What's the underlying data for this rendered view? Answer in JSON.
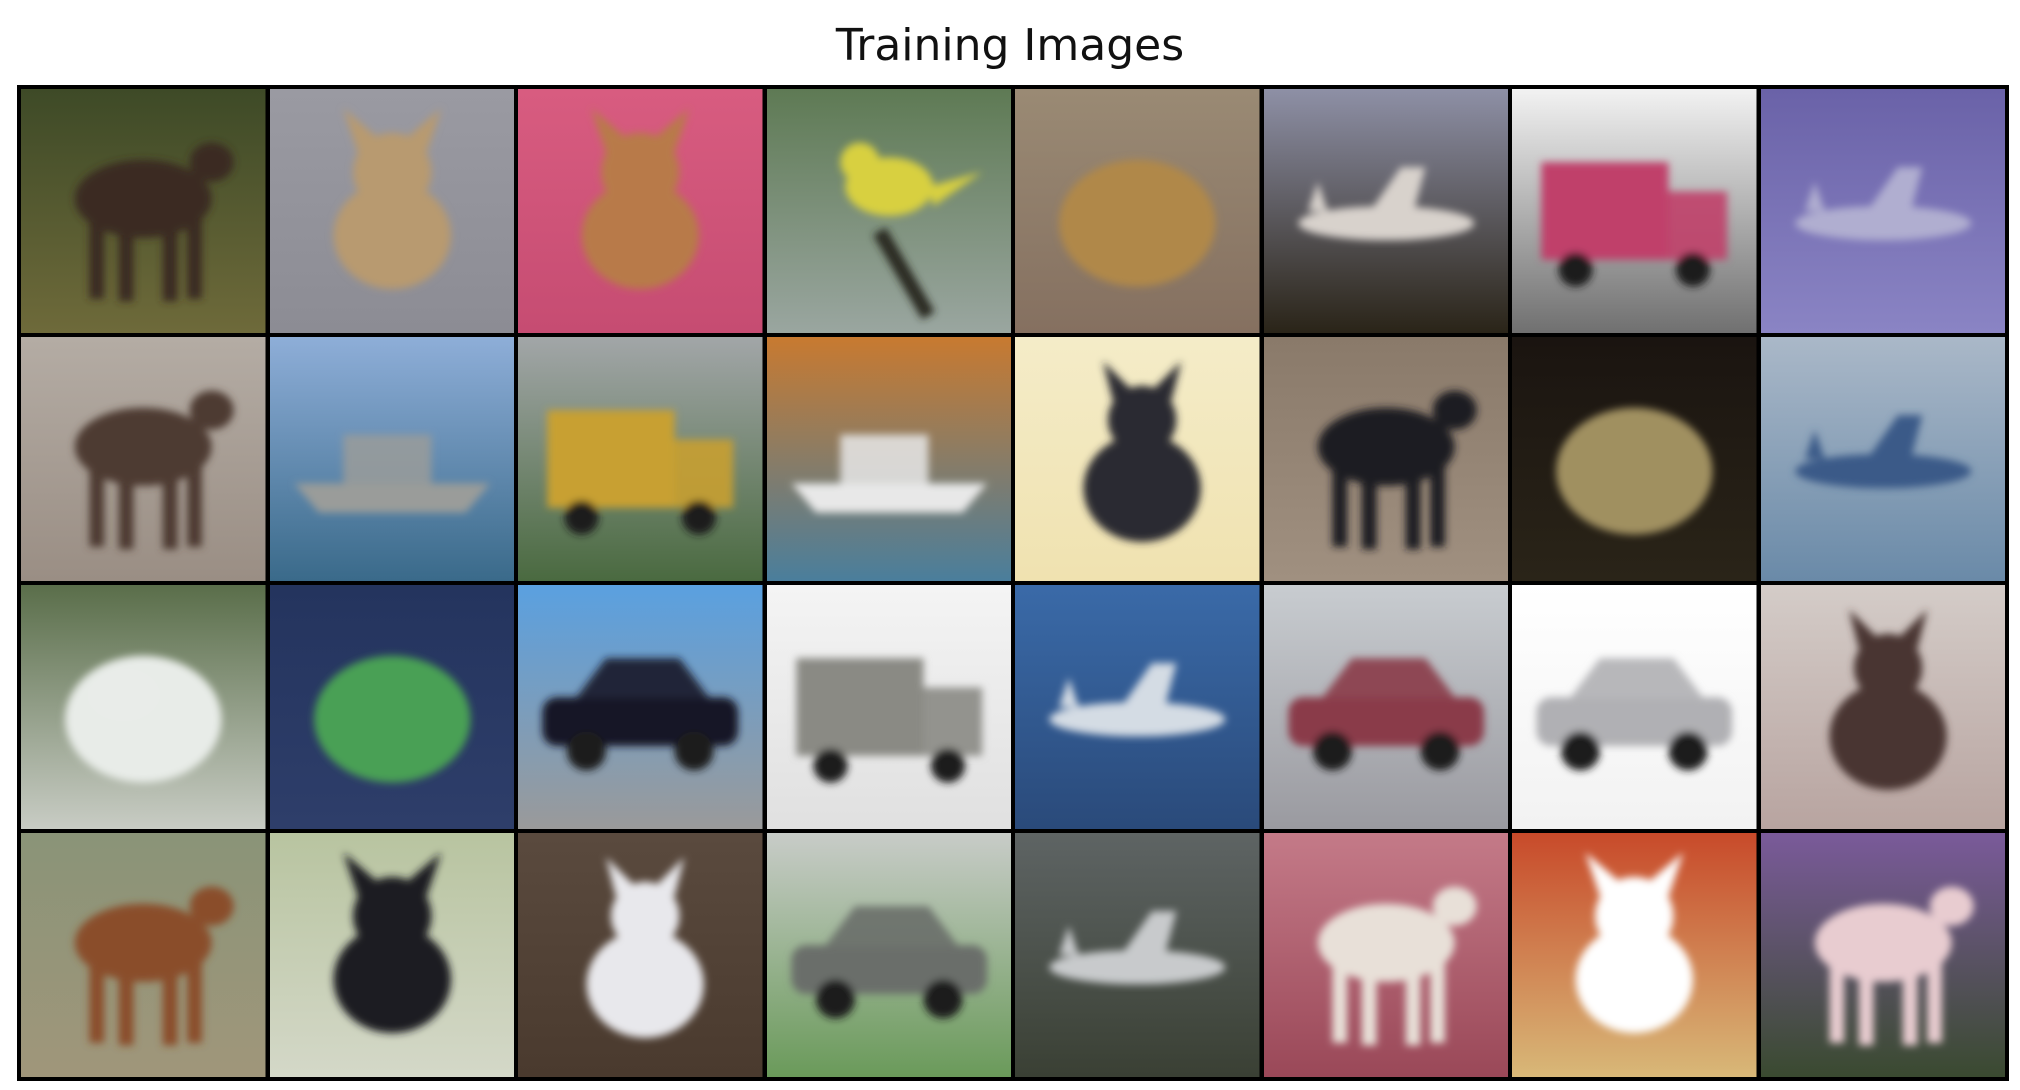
{
  "title": "Training Images",
  "grid": {
    "rows": 4,
    "cols": 8
  },
  "images": [
    {
      "subject": "moose",
      "bg": [
        "#3e4a27",
        "#6e6a3a"
      ],
      "fg": "#3a2a20",
      "shape": "quad"
    },
    {
      "subject": "dog",
      "bg": [
        "#9a9aa2",
        "#8c8c94"
      ],
      "fg": "#b89a70",
      "shape": "dog"
    },
    {
      "subject": "dog",
      "bg": [
        "#d85c80",
        "#c64c72"
      ],
      "fg": "#b87a48",
      "shape": "dog"
    },
    {
      "subject": "bird",
      "bg": [
        "#5e7a54",
        "#9aa6a0"
      ],
      "fg": "#d8d040",
      "shape": "bird"
    },
    {
      "subject": "frog",
      "bg": [
        "#9a8a74",
        "#857060"
      ],
      "fg": "#b08848",
      "shape": "blob"
    },
    {
      "subject": "airplane",
      "bg": [
        "#8e90a6",
        "#2a2418"
      ],
      "fg": "#d8d2cc",
      "shape": "plane"
    },
    {
      "subject": "truck",
      "bg": [
        "#f2f2f2",
        "#707070"
      ],
      "fg": "#c0406a",
      "shape": "truck"
    },
    {
      "subject": "airplane",
      "bg": [
        "#6a62a8",
        "#8a84c4"
      ],
      "fg": "#b0aed0",
      "shape": "plane"
    },
    {
      "subject": "deer",
      "bg": [
        "#b4aca4",
        "#9a8e84"
      ],
      "fg": "#4e3a30",
      "shape": "quad"
    },
    {
      "subject": "ship",
      "bg": [
        "#8eaed8",
        "#3a6a8a"
      ],
      "fg": "#9a9c9a",
      "shape": "ship"
    },
    {
      "subject": "truck",
      "bg": [
        "#a2a6a8",
        "#4a6a40"
      ],
      "fg": "#c8a030",
      "shape": "truck"
    },
    {
      "subject": "ship",
      "bg": [
        "#c87a30",
        "#4a7e9c"
      ],
      "fg": "#e8e8e8",
      "shape": "ship"
    },
    {
      "subject": "cat",
      "bg": [
        "#f4ecc8",
        "#f0e2b0"
      ],
      "fg": "#2a2a30",
      "shape": "cat"
    },
    {
      "subject": "horse",
      "bg": [
        "#8a7a6a",
        "#a09080"
      ],
      "fg": "#1e1a20",
      "shape": "quad"
    },
    {
      "subject": "frog",
      "bg": [
        "#1a1410",
        "#2a2418"
      ],
      "fg": "#a09060",
      "shape": "blob"
    },
    {
      "subject": "airplane",
      "bg": [
        "#aab8c8",
        "#6a8aa8"
      ],
      "fg": "#3a5a88",
      "shape": "plane"
    },
    {
      "subject": "deer",
      "bg": [
        "#5a6e4a",
        "#c8ccc4"
      ],
      "fg": "#e8ece8",
      "shape": "blob"
    },
    {
      "subject": "frog",
      "bg": [
        "#24345e",
        "#2e3e6a"
      ],
      "fg": "#4aa054",
      "shape": "blob"
    },
    {
      "subject": "automobile",
      "bg": [
        "#5aa0e0",
        "#9a9a9a"
      ],
      "fg": "#141828",
      "shape": "car"
    },
    {
      "subject": "truck",
      "bg": [
        "#f4f4f4",
        "#e0e0e0"
      ],
      "fg": "#8a8a84",
      "shape": "truck"
    },
    {
      "subject": "airplane",
      "bg": [
        "#3a6aa8",
        "#2a4a7a"
      ],
      "fg": "#d4dce4",
      "shape": "plane"
    },
    {
      "subject": "automobile",
      "bg": [
        "#c8ccd0",
        "#9a9aa0"
      ],
      "fg": "#8a3a48",
      "shape": "car"
    },
    {
      "subject": "automobile",
      "bg": [
        "#ffffff",
        "#f2f2f2"
      ],
      "fg": "#b0b0b4",
      "shape": "car"
    },
    {
      "subject": "cat",
      "bg": [
        "#d4ccc8",
        "#b8a4a0"
      ],
      "fg": "#4a3630",
      "shape": "cat"
    },
    {
      "subject": "horse",
      "bg": [
        "#8a9478",
        "#a0967a"
      ],
      "fg": "#8a4e2a",
      "shape": "quad"
    },
    {
      "subject": "dog",
      "bg": [
        "#b8c4a0",
        "#d4d8c8"
      ],
      "fg": "#1a1a22",
      "shape": "dog"
    },
    {
      "subject": "cat",
      "bg": [
        "#5a4a3e",
        "#4a3a2e"
      ],
      "fg": "#e8e8ec",
      "shape": "cat"
    },
    {
      "subject": "automobile",
      "bg": [
        "#c8ccc8",
        "#6a9a5a"
      ],
      "fg": "#6a6e6a",
      "shape": "car"
    },
    {
      "subject": "airplane",
      "bg": [
        "#5e6464",
        "#3a4034"
      ],
      "fg": "#c8cacc",
      "shape": "plane"
    },
    {
      "subject": "horse",
      "bg": [
        "#c47a88",
        "#9a4858"
      ],
      "fg": "#e8e0d8",
      "shape": "quad"
    },
    {
      "subject": "dog",
      "bg": [
        "#c84a2a",
        "#d8b878"
      ],
      "fg": "#ffffff",
      "shape": "dog"
    },
    {
      "subject": "deer",
      "bg": [
        "#7a5a9a",
        "#3a4a30"
      ],
      "fg": "#e8ccd0",
      "shape": "quad"
    }
  ]
}
